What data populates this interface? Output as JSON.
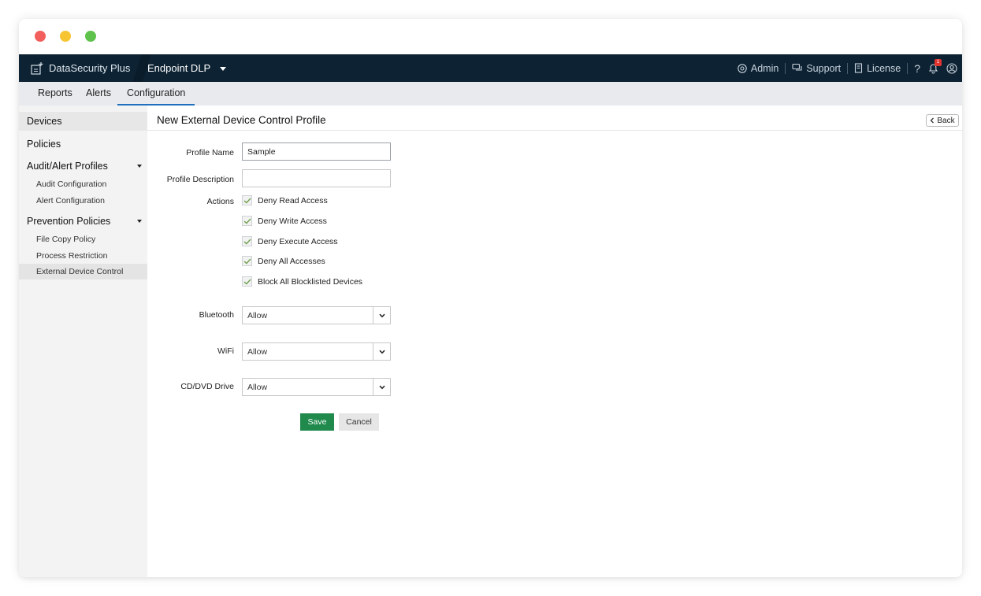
{
  "app": {
    "name": "DataSecurity Plus",
    "module": "Endpoint DLP",
    "top_right": {
      "admin": "Admin",
      "support": "Support",
      "license": "License",
      "help": "?",
      "notification_count": "1"
    }
  },
  "subnav": {
    "tabs": [
      {
        "label": "Reports"
      },
      {
        "label": "Alerts"
      },
      {
        "label": "Configuration",
        "active": true
      }
    ]
  },
  "sidebar": {
    "items": [
      {
        "label": "Devices"
      },
      {
        "label": "Policies"
      },
      {
        "label": "Audit/Alert Profiles"
      },
      {
        "label": "Audit Configuration"
      },
      {
        "label": "Alert Configuration"
      },
      {
        "label": "Prevention Policies"
      },
      {
        "label": "File Copy Policy"
      },
      {
        "label": "Process Restriction"
      },
      {
        "label": "External Device Control",
        "selected": true
      }
    ]
  },
  "page": {
    "title": "New External Device Control Profile",
    "back_label": "Back"
  },
  "form": {
    "profile_name_label": "Profile Name",
    "profile_name_value": "Sample",
    "profile_description_label": "Profile Description",
    "profile_description_value": "",
    "actions_label": "Actions",
    "actions": [
      {
        "label": "Deny Read Access",
        "checked": true
      },
      {
        "label": "Deny Write Access",
        "checked": true
      },
      {
        "label": "Deny Execute Access",
        "checked": true
      },
      {
        "label": "Deny All Accesses",
        "checked": true
      },
      {
        "label": "Block All Blocklisted Devices",
        "checked": true
      }
    ],
    "bluetooth_label": "Bluetooth",
    "bluetooth_value": "Allow",
    "wifi_label": "WiFi",
    "wifi_value": "Allow",
    "cddvd_label": "CD/DVD Drive",
    "cddvd_value": "Allow",
    "save_label": "Save",
    "cancel_label": "Cancel"
  },
  "colors": {
    "appbar": "#0d2233",
    "accent_tab": "#1f6fbf",
    "save_button": "#1f8a4c",
    "check": "#6ea04a"
  }
}
